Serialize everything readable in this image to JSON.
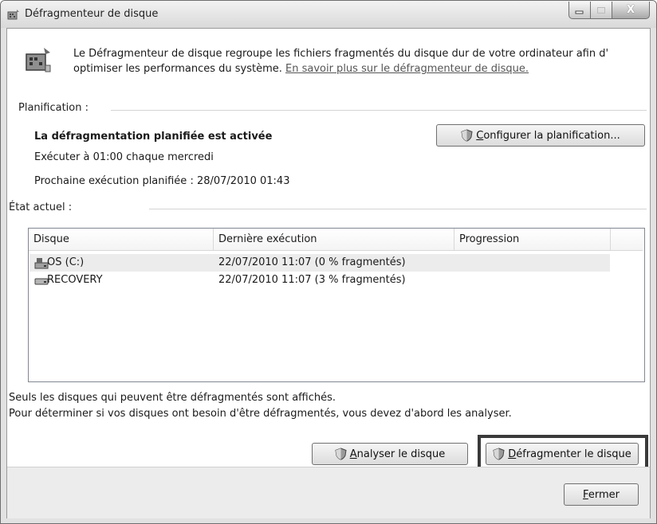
{
  "window": {
    "title": "Défragmenteur de disque",
    "controls": {
      "minimize_icon": "minimize-icon",
      "maximize_icon": "maximize-icon",
      "close_label": "X"
    }
  },
  "intro": {
    "text": "Le Défragmenteur de disque regroupe les fichiers fragmentés du disque dur de votre ordinateur afin d' optimiser les performances du système. ",
    "link": "En savoir plus sur le défragmenteur de disque."
  },
  "schedule": {
    "section_label": "Planification :",
    "status": "La défragmentation planifiée est activée",
    "run_at": "Exécuter à 01:00 chaque mercredi",
    "next_run": "Prochaine exécution planifiée : 28/07/2010 01:43",
    "configure_button": "Configurer la planification..."
  },
  "current_state": {
    "section_label": "État actuel :",
    "columns": [
      "Disque",
      "Dernière exécution",
      "Progression"
    ],
    "rows": [
      {
        "disk": "OS (C:)",
        "last_run": "22/07/2010 11:07 (0 % fragmentés)",
        "progress": "",
        "icon": "system-drive-icon"
      },
      {
        "disk": "RECOVERY",
        "last_run": "22/07/2010 11:07 (3 % fragmentés)",
        "progress": "",
        "icon": "drive-icon"
      }
    ]
  },
  "notes": {
    "line1": "Seuls les disques qui peuvent être défragmentés sont affichés.",
    "line2": "Pour déterminer si vos disques ont besoin d'être défragmentés, vous devez d'abord les analyser."
  },
  "actions": {
    "analyze_button": "Analyser le disque",
    "defragment_button": "Défragmenter le disque",
    "close_button": "Fermer"
  },
  "colors": {
    "highlight_border": "#3a3a3a",
    "link": "#555555"
  }
}
